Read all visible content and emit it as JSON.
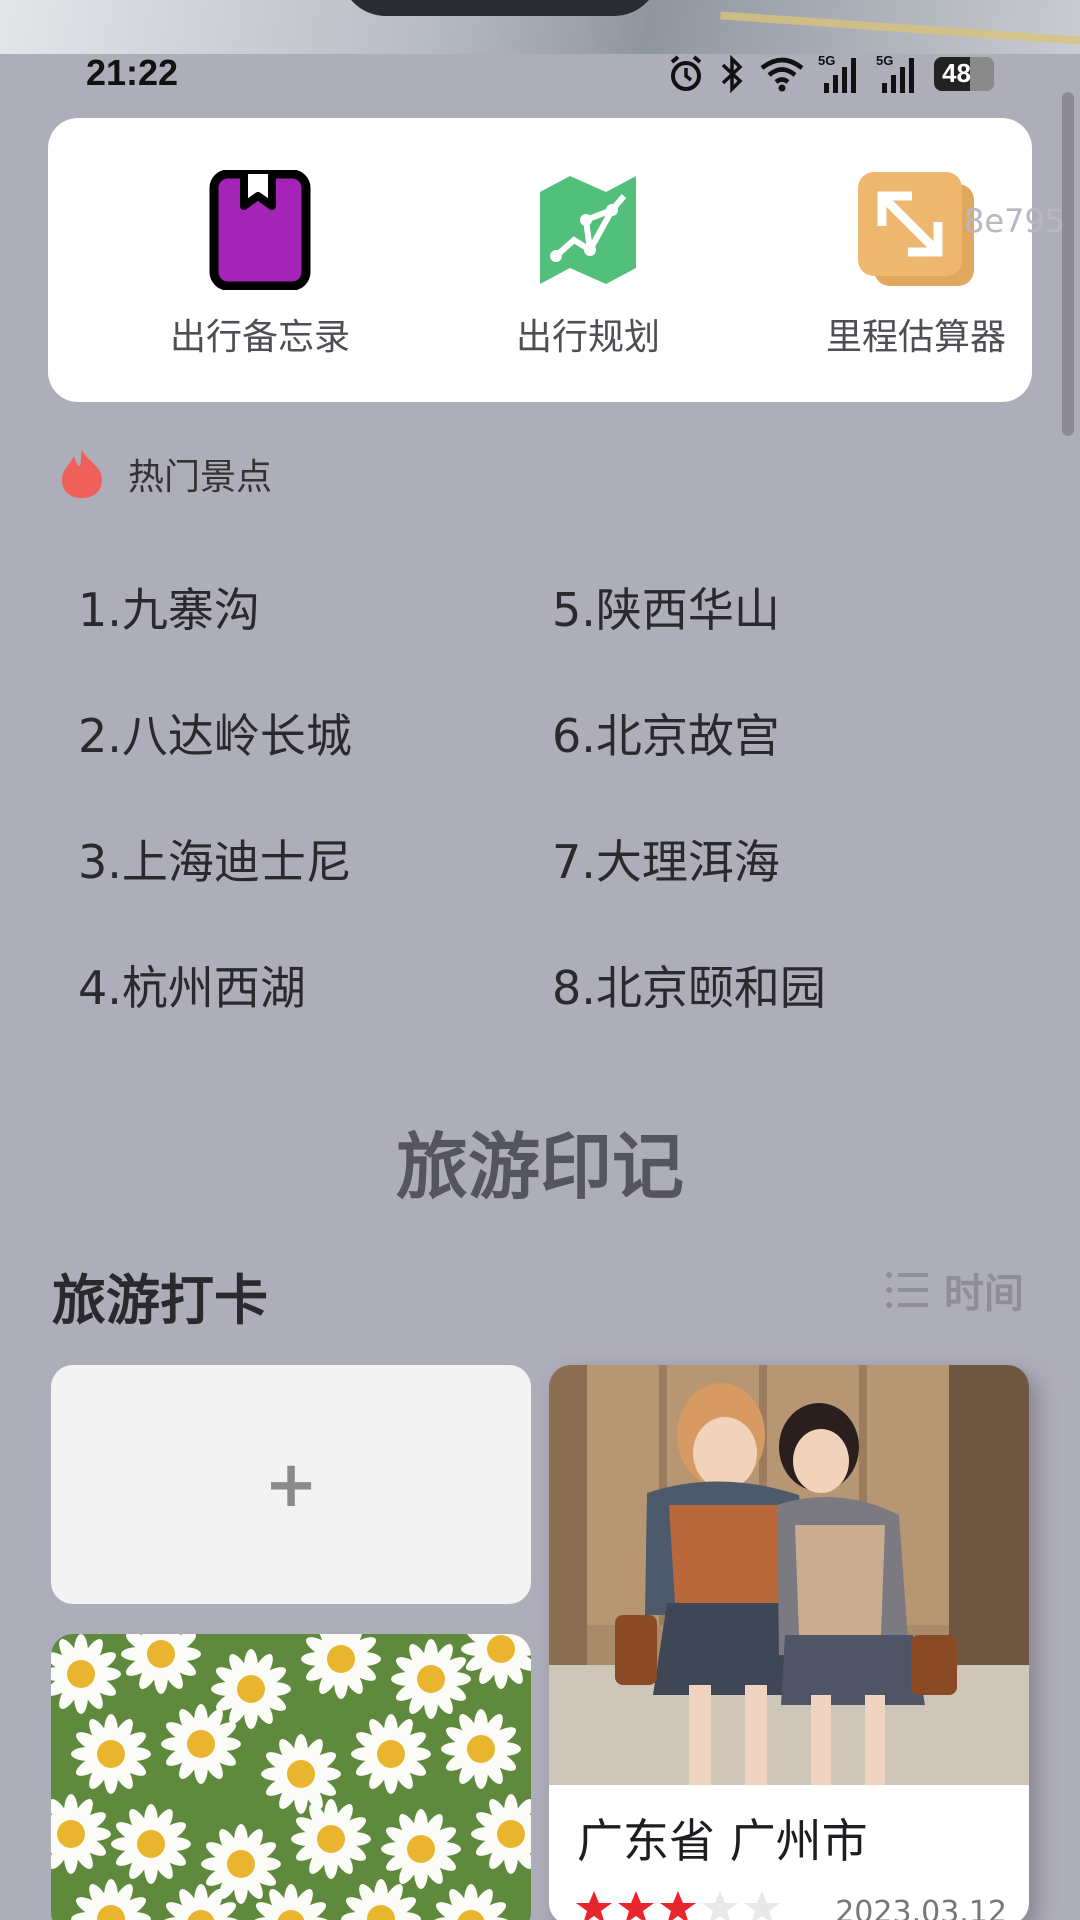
{
  "status_bar": {
    "time": "21:22",
    "battery": "48",
    "icons": [
      "alarm-icon",
      "bluetooth-icon",
      "wifi-icon",
      "signal-5g-icon",
      "signal-5g-icon"
    ],
    "signal_label": "5G"
  },
  "tools": [
    {
      "label": "出行备忘录",
      "icon": "bookmark-book-icon",
      "color": "#a424b8"
    },
    {
      "label": "出行规划",
      "icon": "route-map-icon",
      "color": "#52c07a"
    },
    {
      "label": "里程估算器",
      "icon": "resize-arrows-icon",
      "color": "#e9b46c"
    }
  ],
  "ghost_text": "8e795",
  "hot_spots": {
    "title": "热门景点",
    "icon": "flame-icon",
    "items": [
      "1.九寨沟",
      "2.八达岭长城",
      "3.上海迪士尼",
      "4.杭州西湖",
      "5.陕西华山",
      "6.北京故宫",
      "7.大理洱海",
      "8.北京颐和园"
    ]
  },
  "section_title": "旅游印记",
  "checkin": {
    "title": "旅游打卡",
    "sort_label": "时间",
    "add_label": "+",
    "cards": [
      {
        "location": "广东省 广州市",
        "rating": 3,
        "max_rating": 5,
        "date": "2023.03.12"
      }
    ]
  },
  "colors": {
    "background": "#aeadba",
    "flame": "#f0605a",
    "star_active": "#e8262d",
    "star_inactive": "#e8e8e8"
  }
}
